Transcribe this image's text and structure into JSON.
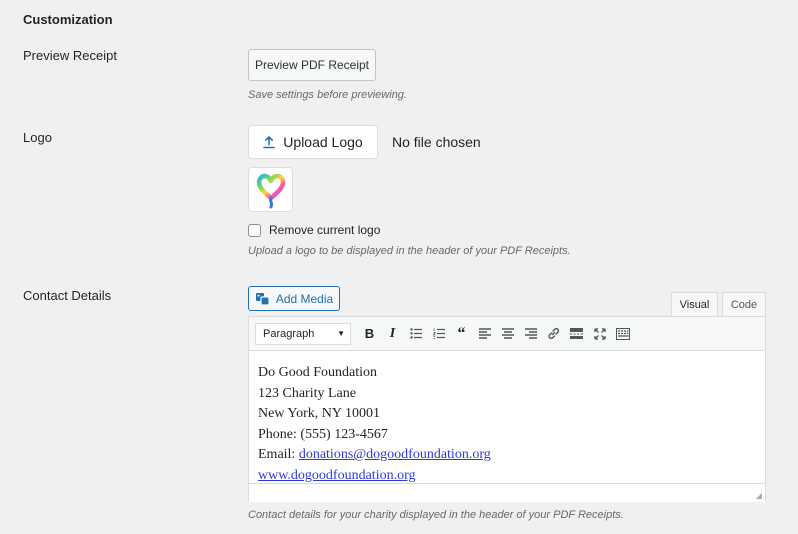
{
  "section": {
    "title": "Customization"
  },
  "preview_receipt": {
    "label": "Preview Receipt",
    "button_label": "Preview PDF Receipt",
    "description": "Save settings before previewing."
  },
  "logo": {
    "label": "Logo",
    "upload_button_label": "Upload Logo",
    "file_status": "No file chosen",
    "remove_label": "Remove current logo",
    "remove_checked": false,
    "description": "Upload a logo to be displayed in the header of your PDF Receipts."
  },
  "contact_details": {
    "label": "Contact Details",
    "add_media_label": "Add Media",
    "tabs": [
      {
        "label": "Visual",
        "active": true
      },
      {
        "label": "Code",
        "active": false
      }
    ],
    "format_select": "Paragraph",
    "toolbar_icons": [
      "bold-icon",
      "italic-icon",
      "bullet-list-icon",
      "numbered-list-icon",
      "blockquote-icon",
      "align-left-icon",
      "align-center-icon",
      "align-right-icon",
      "link-icon",
      "read-more-icon",
      "fullscreen-icon",
      "toolbar-toggle-icon"
    ],
    "content_lines": [
      "Do Good Foundation",
      "123 Charity Lane",
      "New York, NY 10001",
      "Phone: (555) 123-4567"
    ],
    "email_prefix": "Email: ",
    "email_link": "donations@dogoodfoundation.org",
    "website_link": "www.dogoodfoundation.org",
    "description": "Contact details for your charity displayed in the header of your PDF Receipts."
  },
  "colors": {
    "accent": "#2271b1",
    "link": "#2d3ae0",
    "background": "#f0f0f1"
  }
}
